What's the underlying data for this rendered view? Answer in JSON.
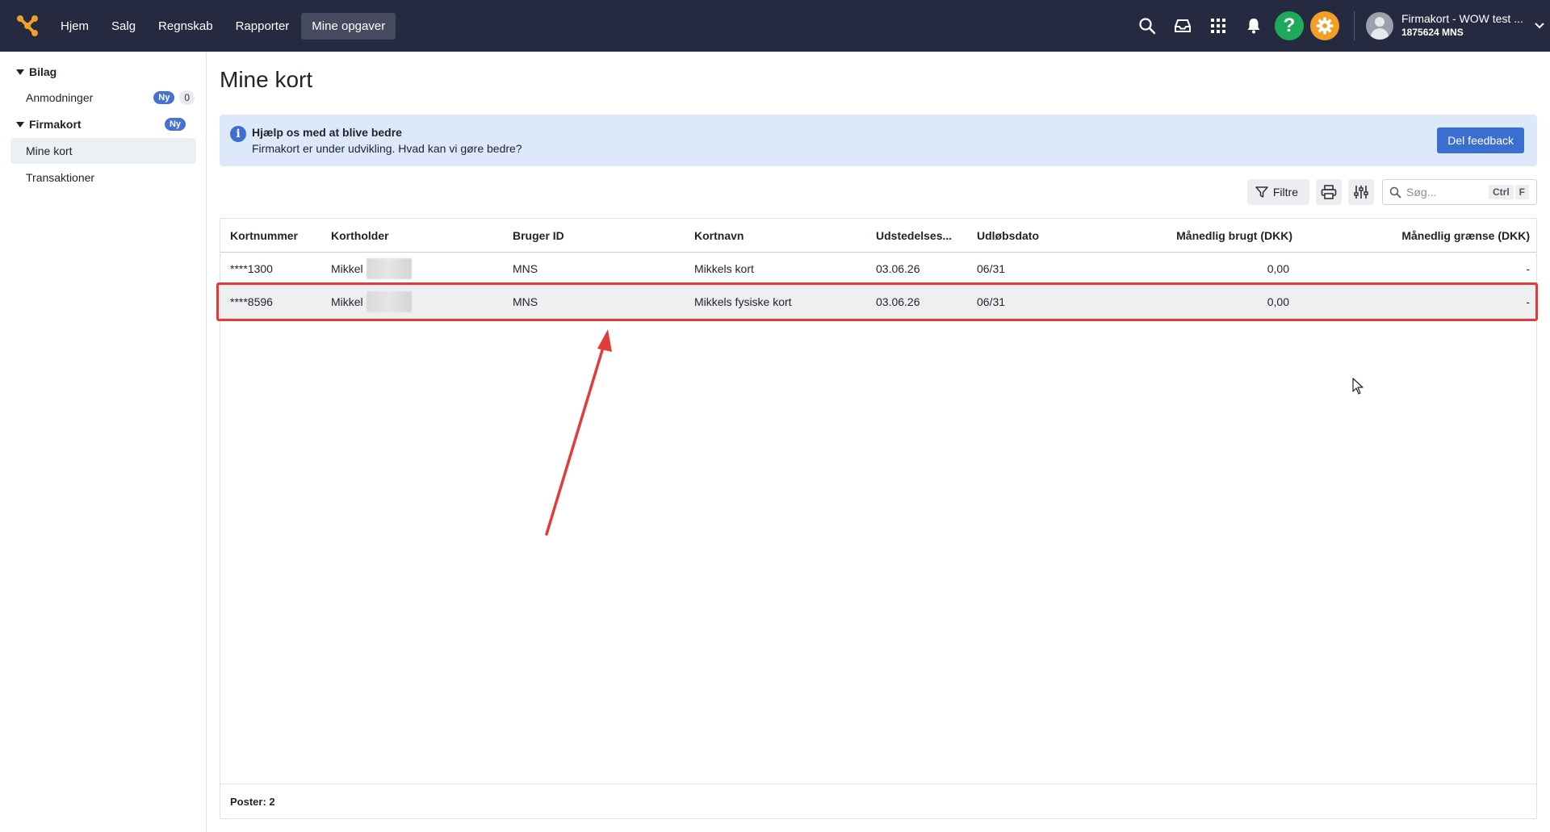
{
  "nav": {
    "items": [
      "Hjem",
      "Salg",
      "Regnskab",
      "Rapporter",
      "Mine opgaver"
    ],
    "active": "Mine opgaver"
  },
  "header_icons": [
    "search-icon",
    "inbox-icon",
    "apps-grid-icon",
    "bell-icon",
    "help-icon",
    "gear-icon"
  ],
  "user": {
    "name": "Firmakort - WOW test ...",
    "sub": "1875624 MNS"
  },
  "sidebar": {
    "groups": [
      {
        "label": "Bilag",
        "items": [
          {
            "label": "Anmodninger",
            "badge_new": "Ny",
            "count": "0"
          }
        ]
      },
      {
        "label": "Firmakort",
        "badge_new": "Ny",
        "items": [
          {
            "label": "Mine kort",
            "active": true
          },
          {
            "label": "Transaktioner"
          }
        ]
      }
    ]
  },
  "page": {
    "title": "Mine kort"
  },
  "banner": {
    "title": "Hjælp os med at blive bedre",
    "text": "Firmakort er under udvikling. Hvad kan vi gøre bedre?",
    "button": "Del feedback"
  },
  "toolbar": {
    "filter_label": "Filtre",
    "search_placeholder": "Søg...",
    "shortcut_ctrl": "Ctrl",
    "shortcut_key": "F"
  },
  "table": {
    "columns": [
      "Kortnummer",
      "Kortholder",
      "Bruger ID",
      "Kortnavn",
      "Udstedelses...",
      "Udløbsdato",
      "Månedlig brugt (DKK)",
      "Månedlig grænse (DKK)"
    ],
    "rows": [
      {
        "kortnummer": "****1300",
        "kortholder": "Mikkel",
        "bruger_id": "MNS",
        "kortnavn": "Mikkels kort",
        "udstedelse": "03.06.26",
        "udlob": "06/31",
        "brugt": "0,00",
        "graense": "-"
      },
      {
        "kortnummer": "****8596",
        "kortholder": "Mikkel",
        "bruger_id": "MNS",
        "kortnavn": "Mikkels fysiske kort",
        "udstedelse": "03.06.26",
        "udlob": "06/31",
        "brugt": "0,00",
        "graense": "-"
      }
    ],
    "footer": "Poster: 2"
  },
  "colors": {
    "topbar": "#262a41",
    "accent": "#3a6fcf",
    "highlight": "#e23b3b",
    "help": "#1eaa5a",
    "settings": "#f0a027"
  }
}
